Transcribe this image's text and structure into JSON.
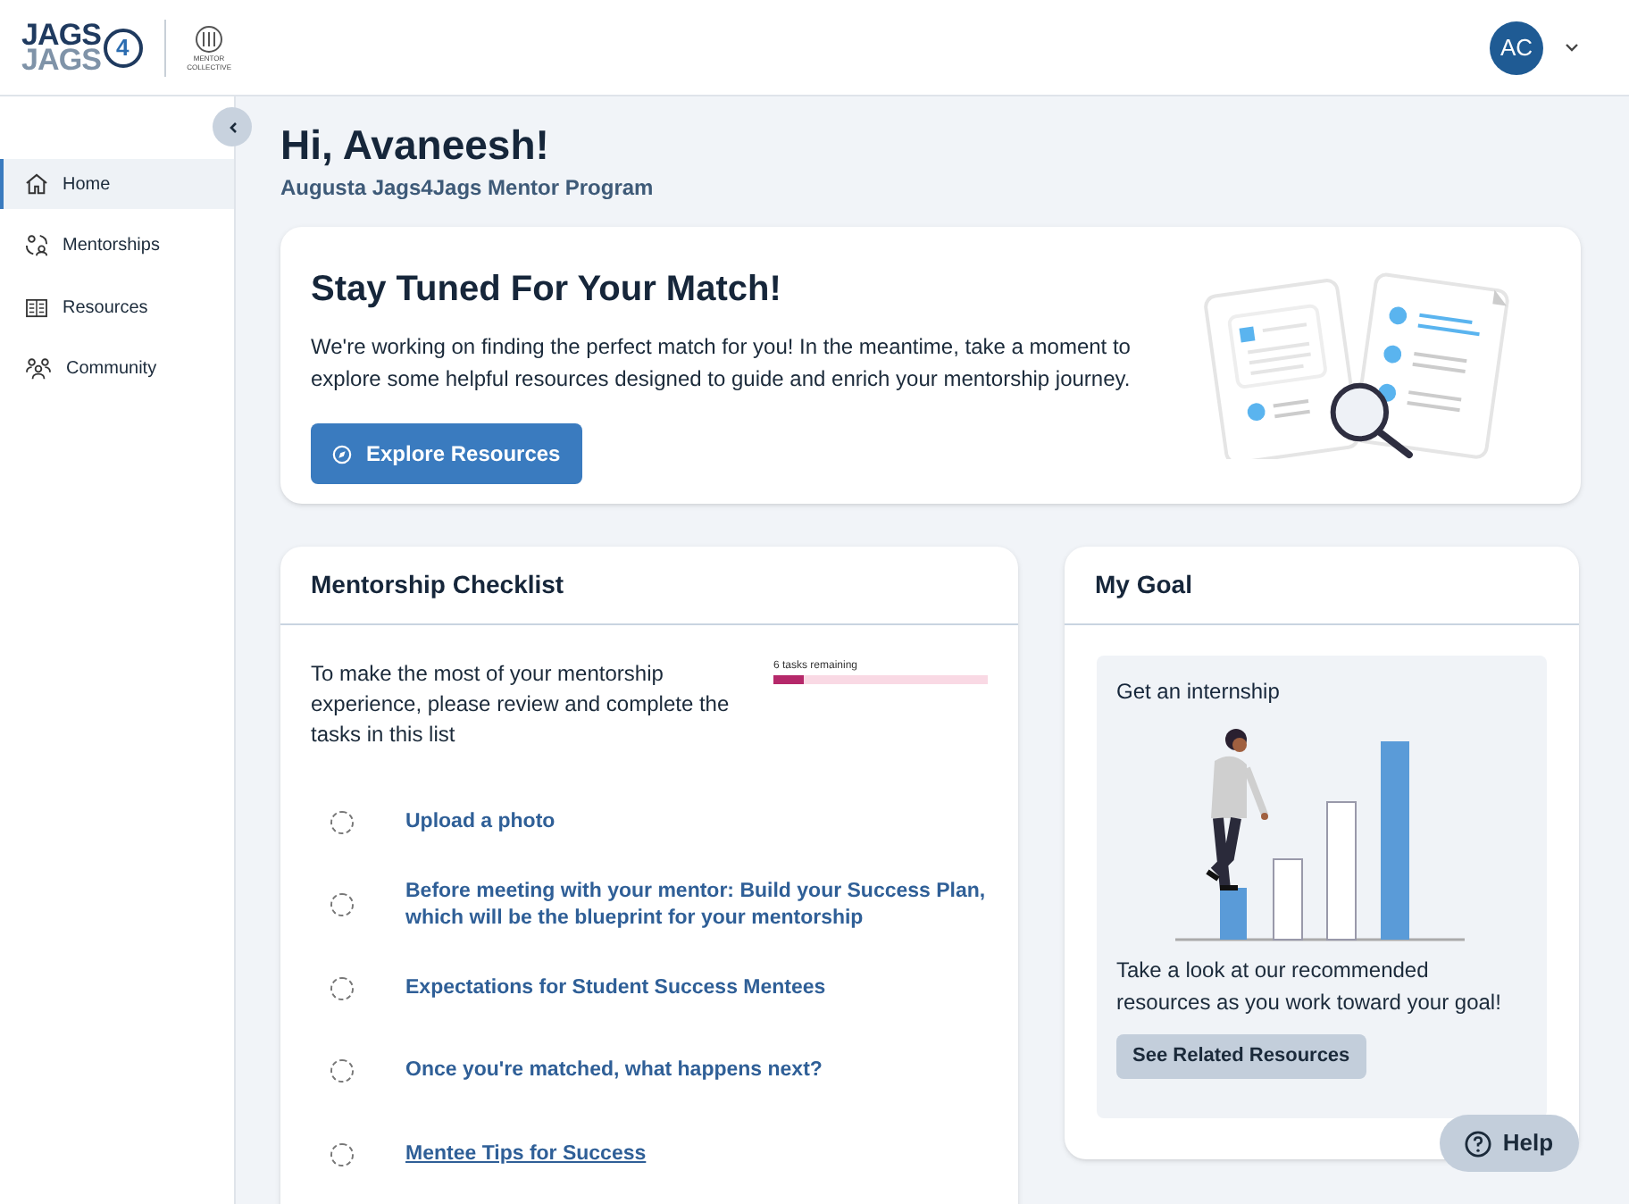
{
  "header": {
    "logo": {
      "line_1": "JAGS",
      "line_2": "JAGS",
      "badge": "4"
    },
    "partner_logo": {
      "line_1": "MENTOR",
      "line_2": "COLLECTIVE"
    },
    "avatar": {
      "initials": "AC"
    }
  },
  "sidebar": {
    "items": [
      {
        "label": "Home",
        "selected": true
      },
      {
        "label": "Mentorships",
        "selected": false
      },
      {
        "label": "Resources",
        "selected": false
      },
      {
        "label": "Community",
        "selected": false
      }
    ]
  },
  "greeting": {
    "title": "Hi, Avaneesh!",
    "subtitle": "Augusta Jags4Jags Mentor Program"
  },
  "hero": {
    "title": "Stay Tuned For Your Match!",
    "text": "We're working on finding the perfect match for you! In the meantime, take a moment to explore some helpful resources designed to guide and enrich your mentorship journey.",
    "button": "Explore Resources"
  },
  "checklist": {
    "title": "Mentorship Checklist",
    "intro": "To make the most of your mentorship experience, please review and complete the tasks in this list",
    "progress": {
      "label": "6 tasks remaining",
      "level": 0.14
    },
    "tasks": [
      {
        "label": "Upload a photo",
        "checked": false,
        "hovered": false
      },
      {
        "label": "Before meeting with your mentor: Build your Success Plan, which will be the blueprint for your mentorship",
        "checked": false,
        "hovered": false
      },
      {
        "label": "Expectations for Student Success Mentees",
        "checked": false,
        "hovered": false
      },
      {
        "label": "Once you're matched, what happens next?",
        "checked": false,
        "hovered": false
      },
      {
        "label": "Mentee Tips for Success",
        "checked": false,
        "hovered": true
      }
    ]
  },
  "goal": {
    "title": "My Goal",
    "goal_name": "Get an internship",
    "text": "Take a look at our recommended resources as you work toward your goal!",
    "button": "See Related Resources"
  },
  "help_button": "Help"
}
